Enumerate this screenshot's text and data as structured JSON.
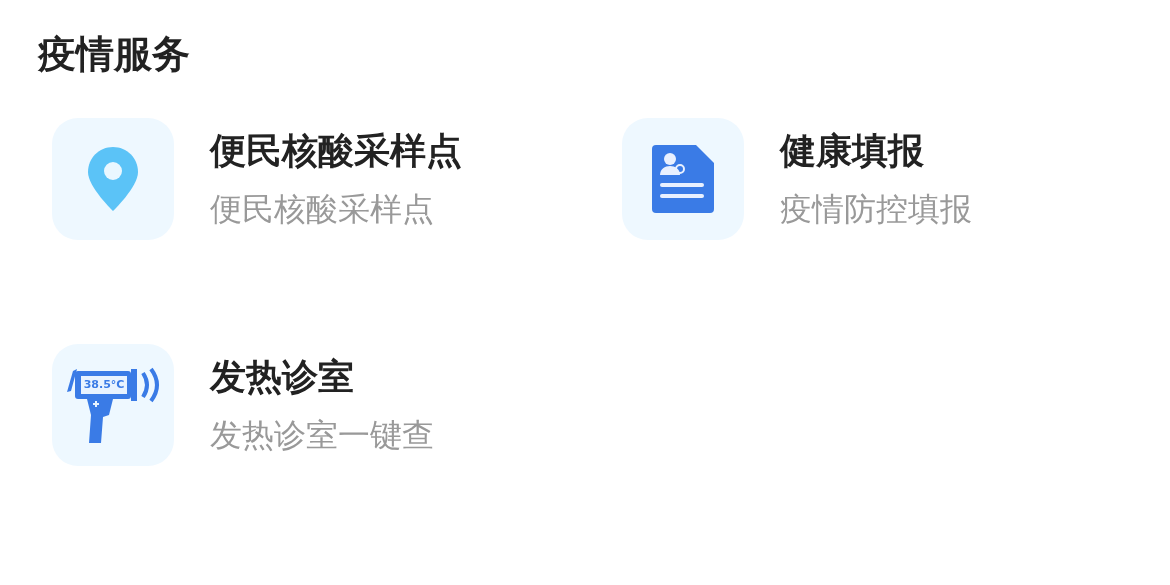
{
  "section": {
    "title": "疫情服务"
  },
  "services": [
    {
      "kind": "location",
      "title": "便民核酸采样点",
      "subtitle": "便民核酸采样点"
    },
    {
      "kind": "form",
      "title": "健康填报",
      "subtitle": "疫情防控填报"
    },
    {
      "kind": "thermometer",
      "title": "发热诊室",
      "subtitle": "发热诊室一键查",
      "display": "38.5°C"
    }
  ]
}
